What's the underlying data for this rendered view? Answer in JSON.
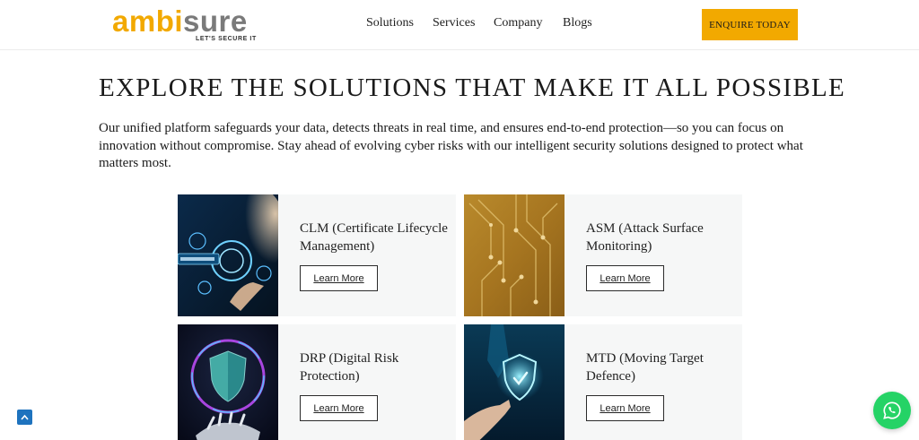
{
  "header": {
    "logo": {
      "brand_part1": "ambi",
      "brand_part2": "sure",
      "tagline": "LET'S SECURE IT"
    },
    "nav": [
      "Solutions",
      "Services",
      "Company",
      "Blogs"
    ],
    "cta_label": "ENQUIRE TODAY"
  },
  "hero": {
    "heading": "EXPLORE THE SOLUTIONS THAT MAKE IT ALL POSSIBLE",
    "intro": "Our unified platform safeguards your data, detects threats in real time, and ensures end-to-end protection—so you can focus on innovation without compromise. Stay ahead of evolving cyber risks with our intelligent security solutions designed to protect what matters most."
  },
  "solutions": [
    {
      "title": "CLM (Certificate Lifecycle Management)",
      "button": "Learn More",
      "image": "standards-hologram"
    },
    {
      "title": "ASM (Attack Surface Monitoring)",
      "button": "Learn More",
      "image": "circuit-board"
    },
    {
      "title": "DRP (Digital Risk Protection)",
      "button": "Learn More",
      "image": "shield-robot-hand"
    },
    {
      "title": "MTD (Moving Target Defence)",
      "button": "Learn More",
      "image": "shield-touch"
    }
  ],
  "floating": {
    "scroll_top_icon": "chevron-up-icon",
    "chat_icon": "whatsapp-icon"
  },
  "colors": {
    "accent": "#f2a900",
    "whatsapp": "#25d366",
    "scroll_top": "#1e73be",
    "card_bg": "#f6f7f7"
  }
}
